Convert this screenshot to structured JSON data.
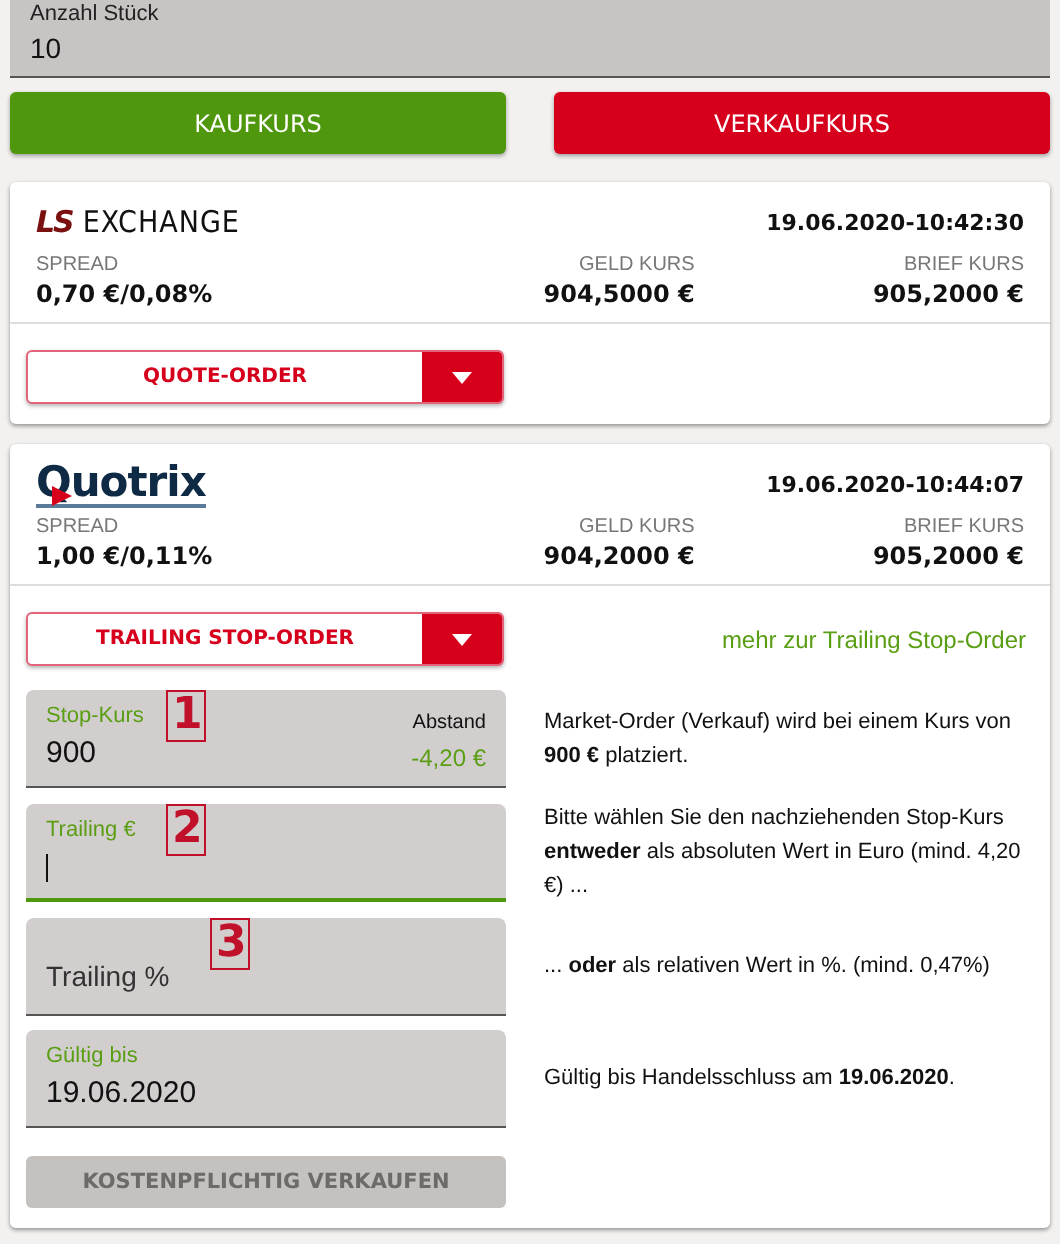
{
  "quantity_field": {
    "label": "Anzahl Stück",
    "value": "10"
  },
  "price_buttons": [
    {
      "label": "KAUFKURS",
      "kind": "buy"
    },
    {
      "label": "VERKAUFKURS",
      "kind": "sell"
    }
  ],
  "exchanges": [
    {
      "logo": {
        "kind": "ls",
        "mark": "LS",
        "text": "EXCHANGE"
      },
      "timestamp": "19.06.2020-10:42:30",
      "spread_label": "SPREAD",
      "spread": "0,70 €/0,08%",
      "bid_label": "GELD KURS",
      "bid": "904,5000 €",
      "ask_label": "BRIEF KURS",
      "ask": "905,2000 €",
      "order_type": "QUOTE-ORDER"
    },
    {
      "logo": {
        "kind": "quotrix",
        "text": "Quotrix"
      },
      "timestamp": "19.06.2020-10:44:07",
      "spread_label": "SPREAD",
      "spread": "1,00 €/0,11%",
      "bid_label": "GELD KURS",
      "bid": "904,2000 €",
      "ask_label": "BRIEF KURS",
      "ask": "905,2000 €",
      "order_type": "TRAILING STOP-ORDER",
      "info_link": "mehr zur Trailing Stop-Order",
      "form": {
        "rows": [
          {
            "field": {
              "label": "Stop-Kurs",
              "value": "900",
              "side_label": "Abstand",
              "side_value": "-4,20 €",
              "focused": false,
              "annotation": "1"
            },
            "info": "Market-Order (Verkauf) wird bei einem Kurs von **900 €** platziert."
          },
          {
            "field": {
              "label": "Trailing €",
              "focused": true,
              "annotation": "2"
            },
            "info": "Bitte wählen Sie den nachziehenden Stop-Kurs **entweder** als absoluten Wert in Euro (mind. 4,20 €) ..."
          },
          {
            "field": {
              "placeholder": "Trailing %",
              "focused": false,
              "annotation": "3"
            },
            "info": "... **oder** als relativen Wert in %. (mind. 0,47%)"
          },
          {
            "field": {
              "label": "Gültig bis",
              "value": "19.06.2020",
              "focused": false
            },
            "info": "Gültig bis Handelsschluss am **19.06.2020**."
          }
        ],
        "submit": {
          "label": "KOSTENPFLICHTIG VERKAUFEN",
          "disabled": true
        }
      }
    }
  ]
}
